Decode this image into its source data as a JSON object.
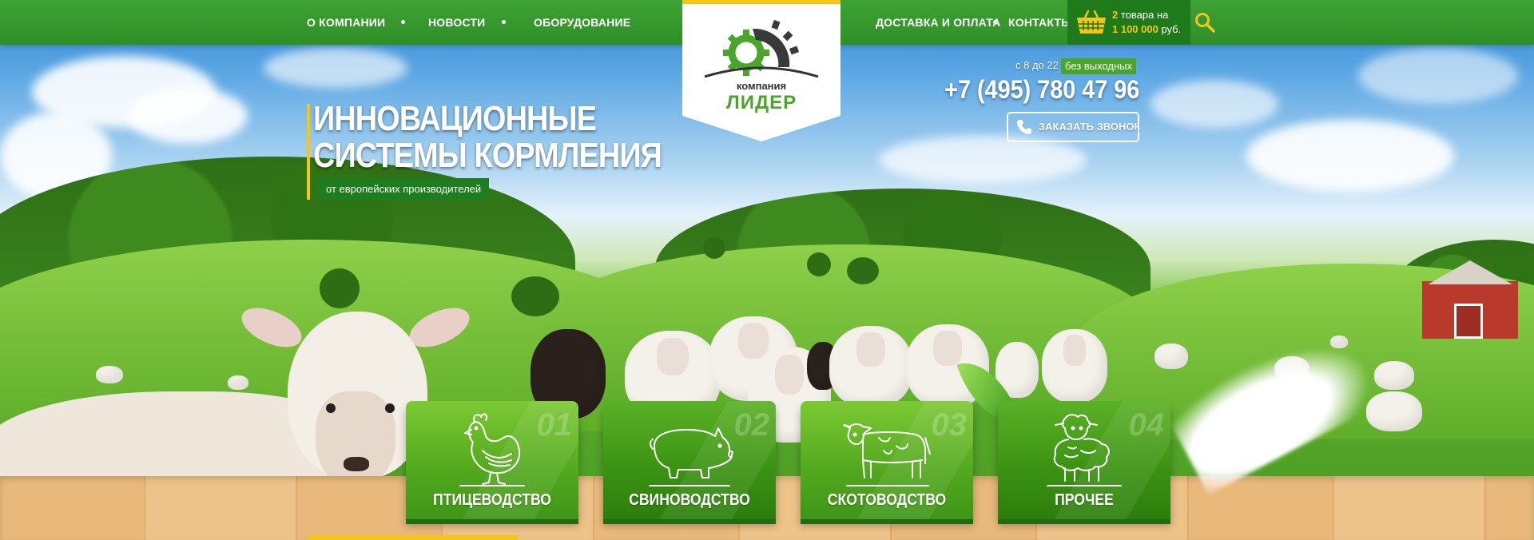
{
  "nav": {
    "left": [
      {
        "label": "О КОМПАНИИ"
      },
      {
        "label": "НОВОСТИ"
      },
      {
        "label": "ОБОРУДОВАНИЕ"
      }
    ],
    "right": [
      {
        "label": "ДОСТАВКА И ОПЛАТА"
      },
      {
        "label": "КОНТАКТЫ"
      }
    ]
  },
  "cart": {
    "count": "2",
    "items_text": " товара на",
    "sum": "1 100 000",
    "currency": " руб.",
    "icon": "basket-icon"
  },
  "search": {
    "icon": "search-icon"
  },
  "logo": {
    "title": "компания",
    "name": "ЛИДЕР"
  },
  "hero": {
    "line1": "ИННОВАЦИОННЫЕ",
    "line2": "СИСТЕМЫ КОРМЛЕНИЯ",
    "subtitle": "от европейских производителей"
  },
  "contact": {
    "hours": "с 8 до 22",
    "hours_badge": "без выходных",
    "phone": "+7 (495) 780 47 96",
    "callback_label": "ЗАКАЗАТЬ ЗВОНОК",
    "callback_icon": "phone-icon"
  },
  "categories": [
    {
      "num": "01",
      "label": "ПТИЦЕВОДСТВО",
      "icon": "chicken-icon"
    },
    {
      "num": "02",
      "label": "СВИНОВОДСТВО",
      "icon": "pig-icon"
    },
    {
      "num": "03",
      "label": "СКОТОВОДСТВО",
      "icon": "cow-icon"
    },
    {
      "num": "04",
      "label": "ПРОЧЕЕ",
      "icon": "sheep-icon"
    }
  ],
  "colors": {
    "accent_green": "#2f8f27",
    "accent_yellow": "#f5c518",
    "dark_green": "#1e7d1f"
  }
}
